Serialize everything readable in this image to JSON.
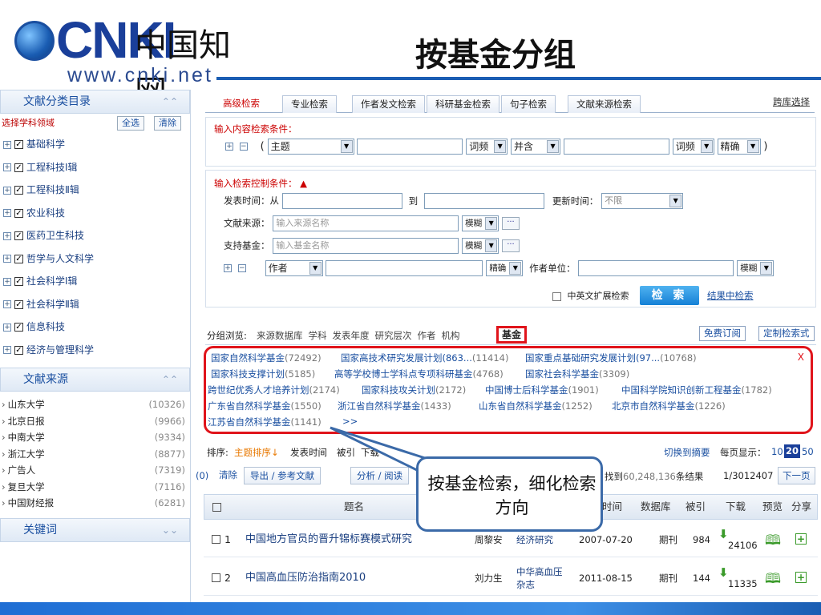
{
  "header": {
    "logo_text": "CNKI",
    "logo_cn": "中国知网",
    "logo_url": "www.cnki.net",
    "title": "按基金分组"
  },
  "sidebar": {
    "category_title": "文献分类目录",
    "select_subject": "选择学科领域",
    "select_all": "全选",
    "clear": "清除",
    "subjects": [
      "基础科学",
      "工程科技Ⅰ辑",
      "工程科技Ⅱ辑",
      "农业科技",
      "医药卫生科技",
      "哲学与人文科学",
      "社会科学Ⅰ辑",
      "社会科学Ⅱ辑",
      "信息科技",
      "经济与管理科学"
    ],
    "source_title": "文献来源",
    "sources": [
      {
        "name": "山东大学",
        "count": "(10326)"
      },
      {
        "name": "北京日报",
        "count": "(9966)"
      },
      {
        "name": "中南大学",
        "count": "(9334)"
      },
      {
        "name": "浙江大学",
        "count": "(8877)"
      },
      {
        "name": "广告人",
        "count": "(7319)"
      },
      {
        "name": "复旦大学",
        "count": "(7116)"
      },
      {
        "name": "中国财经报",
        "count": "(6281)"
      }
    ],
    "keyword_title": "关键词"
  },
  "tabs": [
    "高级检索",
    "专业检索",
    "作者发文检索",
    "科研基金检索",
    "句子检索",
    "文献来源检索"
  ],
  "cross_lib": "跨库选择",
  "content_cond": {
    "label": "输入内容检索条件：",
    "paren_open": "(",
    "paren_close": ")",
    "field1": "主题",
    "freq1": "词频",
    "logic": "并含",
    "freq2": "词频",
    "match": "精确"
  },
  "control_cond": {
    "label": "输入检索控制条件：",
    "pub_time": "发表时间：从",
    "to": "到",
    "update_time": "更新时间：",
    "update_value": "不限",
    "source_label": "文献来源：",
    "source_ph": "输入来源名称",
    "fuzzy1": "模糊",
    "fund_label": "支持基金：",
    "fund_ph": "输入基金名称",
    "fuzzy2": "模糊",
    "author_field": "作者",
    "exact": "精确",
    "unit_label": "作者单位：",
    "fuzzy3": "模糊",
    "bilingual": "中英文扩展检索",
    "search_btn": "检 索",
    "in_result": "结果中检索"
  },
  "group": {
    "label": "分组浏览:",
    "items": [
      "来源数据库",
      "学科",
      "发表年度",
      "研究层次",
      "作者",
      "机构"
    ],
    "active": "基金",
    "free_sub": "免费订阅",
    "custom": "定制检索式",
    "close": "X",
    "funds": [
      [
        {
          "n": "国家自然科学基金",
          "c": "(72492)"
        },
        {
          "n": "国家高技术研究发展计划(863...",
          "c": "(11414)"
        },
        {
          "n": "国家重点基础研究发展计划(97...",
          "c": "(10768)"
        }
      ],
      [
        {
          "n": "国家科技支撑计划",
          "c": "(5185)"
        },
        {
          "n": "高等学校博士学科点专项科研基金",
          "c": "(4768)"
        },
        {
          "n": "国家社会科学基金",
          "c": "(3309)"
        }
      ],
      [
        {
          "n": "跨世纪优秀人才培养计划",
          "c": "(2174)"
        },
        {
          "n": "国家科技攻关计划",
          "c": "(2172)"
        },
        {
          "n": "中国博士后科学基金",
          "c": "(1901)"
        },
        {
          "n": "中国科学院知识创新工程基金",
          "c": "(1782)"
        }
      ],
      [
        {
          "n": "广东省自然科学基金",
          "c": "(1550)"
        },
        {
          "n": "浙江省自然科学基金",
          "c": "(1433)"
        },
        {
          "n": "山东省自然科学基金",
          "c": "(1252)"
        },
        {
          "n": "北京市自然科学基金",
          "c": "(1226)"
        }
      ],
      [
        {
          "n": "江苏省自然科学基金",
          "c": "(1141)"
        },
        {
          "n": ">>",
          "c": ""
        }
      ]
    ]
  },
  "sort": {
    "label": "排序:",
    "active": "主题排序↓",
    "time": "发表时间",
    "cited": "被引",
    "download": "下载",
    "switch": "切换到摘要",
    "per_page": "每页显示：",
    "p10": "10",
    "p20": "20",
    "p50": "50"
  },
  "actions": {
    "count": "(0)",
    "clear": "清除",
    "export": "导出 / 参考文献",
    "analyze": "分析 / 阅读",
    "found_pre": "找到",
    "found_num": "60,248,136",
    "found_post": "条结果",
    "pages": "1/3012407",
    "next": "下一页"
  },
  "table": {
    "headers": [
      "题名",
      "时间",
      "数据库",
      "被引",
      "下载",
      "预览",
      "分享"
    ],
    "rows": [
      {
        "no": "1",
        "title": "中国地方官员的晋升锦标赛模式研究",
        "author": "周黎安",
        "source": "经济研究",
        "date": "2007-07-20",
        "db": "期刊",
        "cited": "984",
        "dl": "24106"
      },
      {
        "no": "2",
        "title": "中国高血压防治指南2010",
        "author": "刘力生",
        "source": "中华高血压杂志",
        "date": "2011-08-15",
        "db": "期刊",
        "cited": "144",
        "dl": "11335"
      }
    ]
  },
  "callout": "按基金检索，细化检索方向"
}
